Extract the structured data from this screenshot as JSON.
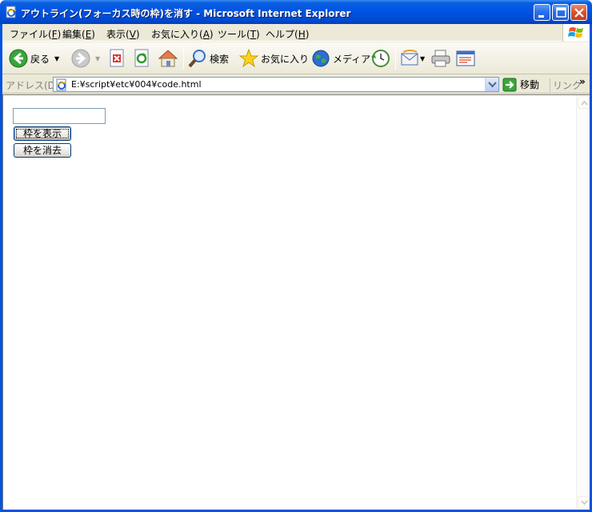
{
  "window": {
    "title": "アウトライン(フォーカス時の枠)を消す - Microsoft Internet Explorer"
  },
  "menubar": {
    "items": [
      {
        "label": "ファイル(",
        "key": "F",
        "end": ")"
      },
      {
        "label": "編集(",
        "key": "E",
        "end": ")"
      },
      {
        "label": "表示(",
        "key": "V",
        "end": ")"
      },
      {
        "label": "お気に入り(",
        "key": "A",
        "end": ")"
      },
      {
        "label": "ツール(",
        "key": "T",
        "end": ")"
      },
      {
        "label": "ヘルプ(",
        "key": "H",
        "end": ")"
      }
    ]
  },
  "toolbar": {
    "back_label": "戻る",
    "search_label": "検索",
    "favorites_label": "お気に入り",
    "media_label": "メディア"
  },
  "addressbar": {
    "label": "アドレス(D)",
    "url": "E:¥script¥etc¥004¥code.html",
    "go_label": "移動",
    "links_label": "リンク",
    "more": "»"
  },
  "page": {
    "text_input_value": "",
    "show_frame_button": "枠を表示",
    "hide_frame_button": "枠を消去"
  },
  "colors": {
    "titlebar": "#0054e3",
    "chrome": "#ece9d8"
  }
}
